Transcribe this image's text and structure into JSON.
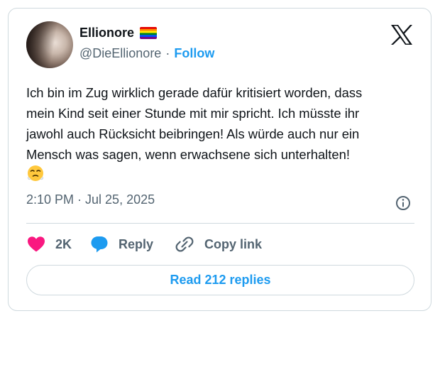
{
  "tweet": {
    "author": {
      "display_name": "Ellionore",
      "handle": "@DieEllionore",
      "separator": "·",
      "follow_label": "Follow",
      "avatar_icon": "profile-photo",
      "badge_icon": "rainbow-flag-emoji"
    },
    "text": "Ich bin im Zug wirklich gerade dafür kritisiert worden, dass\nmein Kind seit einer Stunde mit mir spricht. Ich müsste ihr\njawohl auch Rücksicht beibringen! Als würde auch nur ein\nMensch was sagen, wenn erwachsene sich unterhalten!",
    "emoji": "😤",
    "timestamp": "2:10 PM · Jul 25, 2025",
    "actions": {
      "like_count": "2K",
      "reply_label": "Reply",
      "copy_label": "Copy link"
    },
    "read_replies_label": "Read 212 replies"
  },
  "colors": {
    "accent": "#1d9bf0",
    "like": "#f91880",
    "text": "#0f1419",
    "muted": "#536471",
    "border": "#cfd9de"
  }
}
